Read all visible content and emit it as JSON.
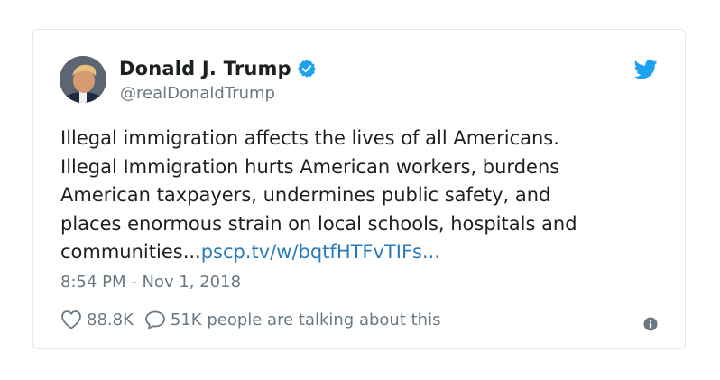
{
  "tweet": {
    "display_name": "Donald J. Trump",
    "handle": "@realDonaldTrump",
    "text_lines": [
      "Illegal immigration affects the lives of all Americans.",
      "Illegal Immigration hurts American workers, burdens",
      "American taxpayers, undermines public safety, and",
      "places enormous strain on local schools, hospitals and"
    ],
    "text_last_prefix": "communities...",
    "link_text": "pscp.tv/w/bqtfHTFvTIFs...",
    "timestamp": "8:54 PM - Nov 1, 2018",
    "likes": "88.8K",
    "talking": "51K people are talking about this"
  },
  "icons": {
    "verified": "verified-badge-icon",
    "brand": "twitter-bird-icon",
    "like": "heart-icon",
    "reply": "speech-bubble-icon",
    "info": "info-icon"
  },
  "colors": {
    "accent": "#1da1f2",
    "link": "#2b7bb9",
    "text": "#1c2022",
    "muted": "#697882",
    "border": "#e1e8ed"
  }
}
